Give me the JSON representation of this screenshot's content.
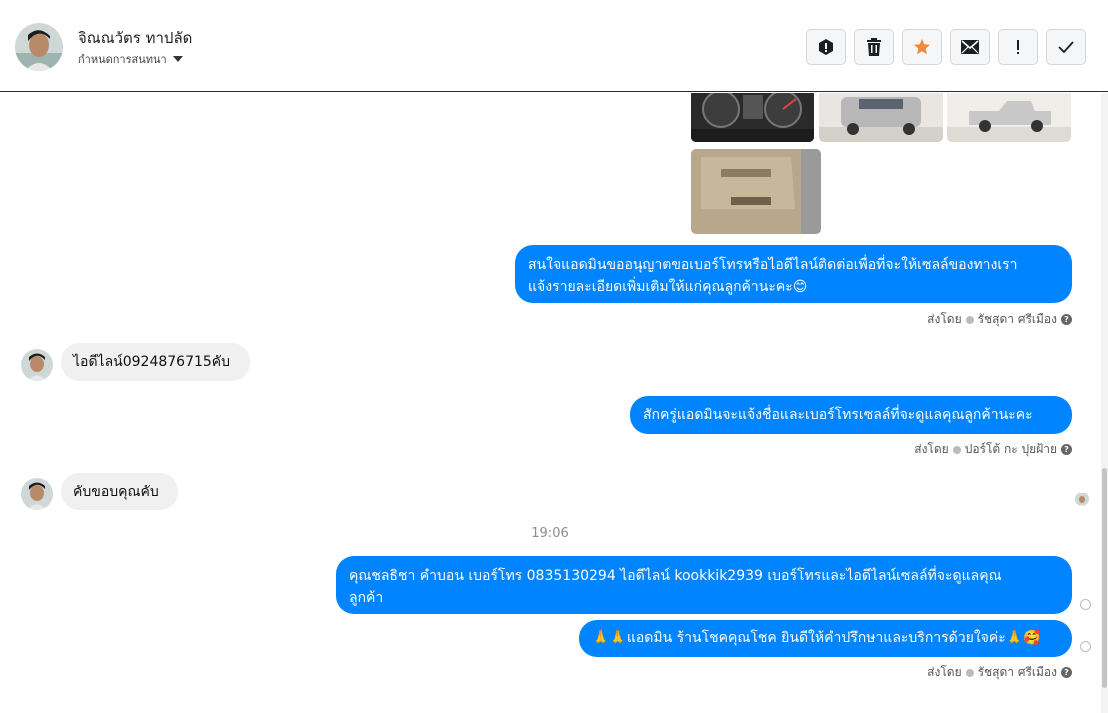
{
  "header": {
    "contact_name": "จิณณวัตร ทาปลัด",
    "subtitle": "กำหนดการสนทนา",
    "toolbar": [
      {
        "name": "alert-icon",
        "color": "#1c1e21"
      },
      {
        "name": "trash-icon",
        "color": "#1c1e21"
      },
      {
        "name": "star-icon",
        "color": "#f5893a"
      },
      {
        "name": "mail-icon",
        "color": "#1c1e21"
      },
      {
        "name": "exclamation-icon",
        "color": "#1c1e21"
      },
      {
        "name": "check-icon",
        "color": "#1c1e21"
      }
    ]
  },
  "messages": [
    {
      "direction": "out",
      "text_line1": "สนใจแอดมินขออนุญาตขอเบอร์โทรหรือไอดีไลน์ติดต่อเพื่อที่จะให้เซลล์ของทางเรา",
      "text_line2": "แจ้งรายละเอียดเพิ่มเติมให้แก่คุณลูกค้านะคะ😊",
      "sent_by_label": "ส่งโดย",
      "sender": "รัชสุดา ศรีเมือง"
    },
    {
      "direction": "in",
      "text": "ไอดีไลน์0924876715คับ"
    },
    {
      "direction": "out",
      "text": "สักครู่แอดมินจะแจ้งชื่อและเบอร์โทรเซลล์ที่จะดูแลคุณลูกค้านะคะ",
      "sent_by_label": "ส่งโดย",
      "sender": "ปอร์โต้ กะ ปุยฝ้าย"
    },
    {
      "direction": "in",
      "text": "คับขอบคุณคับ"
    },
    {
      "direction": "out",
      "text_line1": "คุณชลธิชา คำบอน เบอร์โทร 0835130294 ไอดีไลน์ kookkik2939   เบอร์โทรและไอดีไลน์เซลล์ที่จะดูแลคุณ",
      "text_line2": "ลูกค้า"
    },
    {
      "direction": "out",
      "text": "🙏🙏แอดมิน ร้านโชคคุณโชค ยินดีให้คำปรึกษาและบริการด้วยใจค่ะ🙏🥰",
      "sent_by_label": "ส่งโดย",
      "sender": "รัชสุดา ศรีเมือง"
    }
  ],
  "time_separator": "19:06"
}
